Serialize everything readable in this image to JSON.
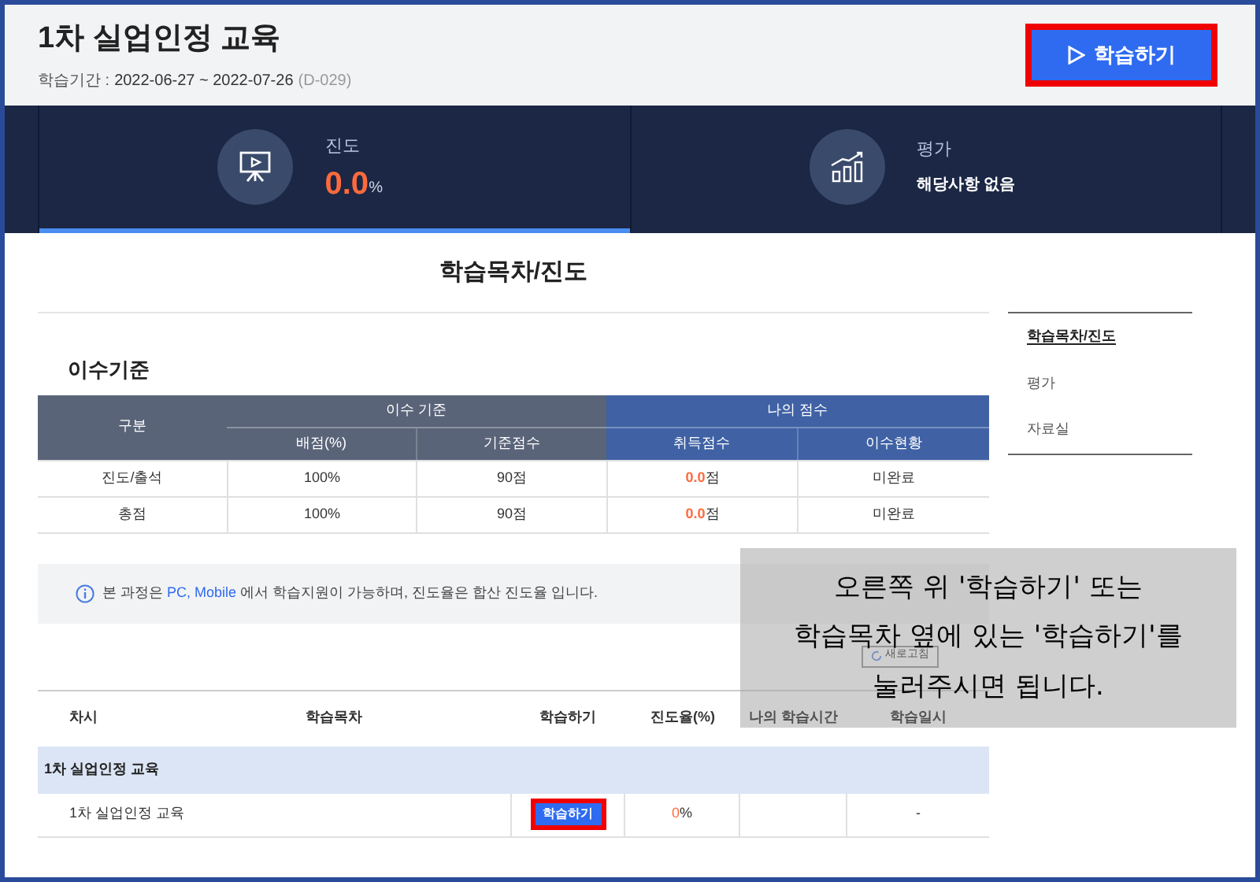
{
  "course": {
    "title": "1차 실업인정 교육",
    "period_label": "학습기간 :",
    "period": "2022-06-27 ~ 2022-07-26",
    "d_day": "(D-029)",
    "study_button": "학습하기",
    "highlighted": true
  },
  "summary_tabs": [
    {
      "kind": "progress",
      "label": "진도",
      "value": "0.0",
      "unit": "%",
      "selected": true
    },
    {
      "kind": "evaluation",
      "label": "평가",
      "value": "해당사항 없음",
      "selected": false
    }
  ],
  "page_title": "학습목차/진도",
  "side_menu": [
    {
      "label": "학습목차/진도",
      "selected": true
    },
    {
      "label": "평가",
      "selected": false
    },
    {
      "label": "자료실",
      "selected": false
    }
  ],
  "criteria": {
    "title": "이수기준",
    "first_column": "구분",
    "groups": [
      {
        "label": "이수 기준",
        "columns": [
          "배점(%)",
          "기준점수"
        ],
        "kind": "standard"
      },
      {
        "label": "나의 점수",
        "columns": [
          "취득점수",
          "이수현황"
        ],
        "kind": "mine"
      }
    ],
    "rows": [
      {
        "category": "진도/출석",
        "weight": "100%",
        "required": "90점",
        "score": "0.0",
        "score_unit": "점",
        "status": "미완료"
      },
      {
        "category": "총점",
        "weight": "100%",
        "required": "90점",
        "score": "0.0",
        "score_unit": "점",
        "status": "미완료"
      }
    ]
  },
  "notice": {
    "before": "본 과정은 ",
    "highlight": "PC, Mobile",
    "after": " 에서 학습지원이 가능하며, 진도율은 합산 진도율 입니다."
  },
  "refresh_button": "새로고침",
  "lessons": {
    "columns": [
      "차시",
      "학습목차",
      "학습하기",
      "진도율(%)",
      "나의 학습시간",
      "학습일시"
    ],
    "groups": [
      {
        "title": "1차 실업인정 교육",
        "items": [
          {
            "title": "1차 실업인정 교육",
            "button": "학습하기",
            "highlighted": true,
            "progress": "0",
            "progress_unit": "%",
            "date": "-"
          }
        ]
      }
    ]
  },
  "annotation": {
    "lines": [
      "오른쪽 위 '학습하기' 또는",
      "학습목차 옆에 있는 '학습하기'를",
      "눌러주시면 됩니다."
    ]
  }
}
